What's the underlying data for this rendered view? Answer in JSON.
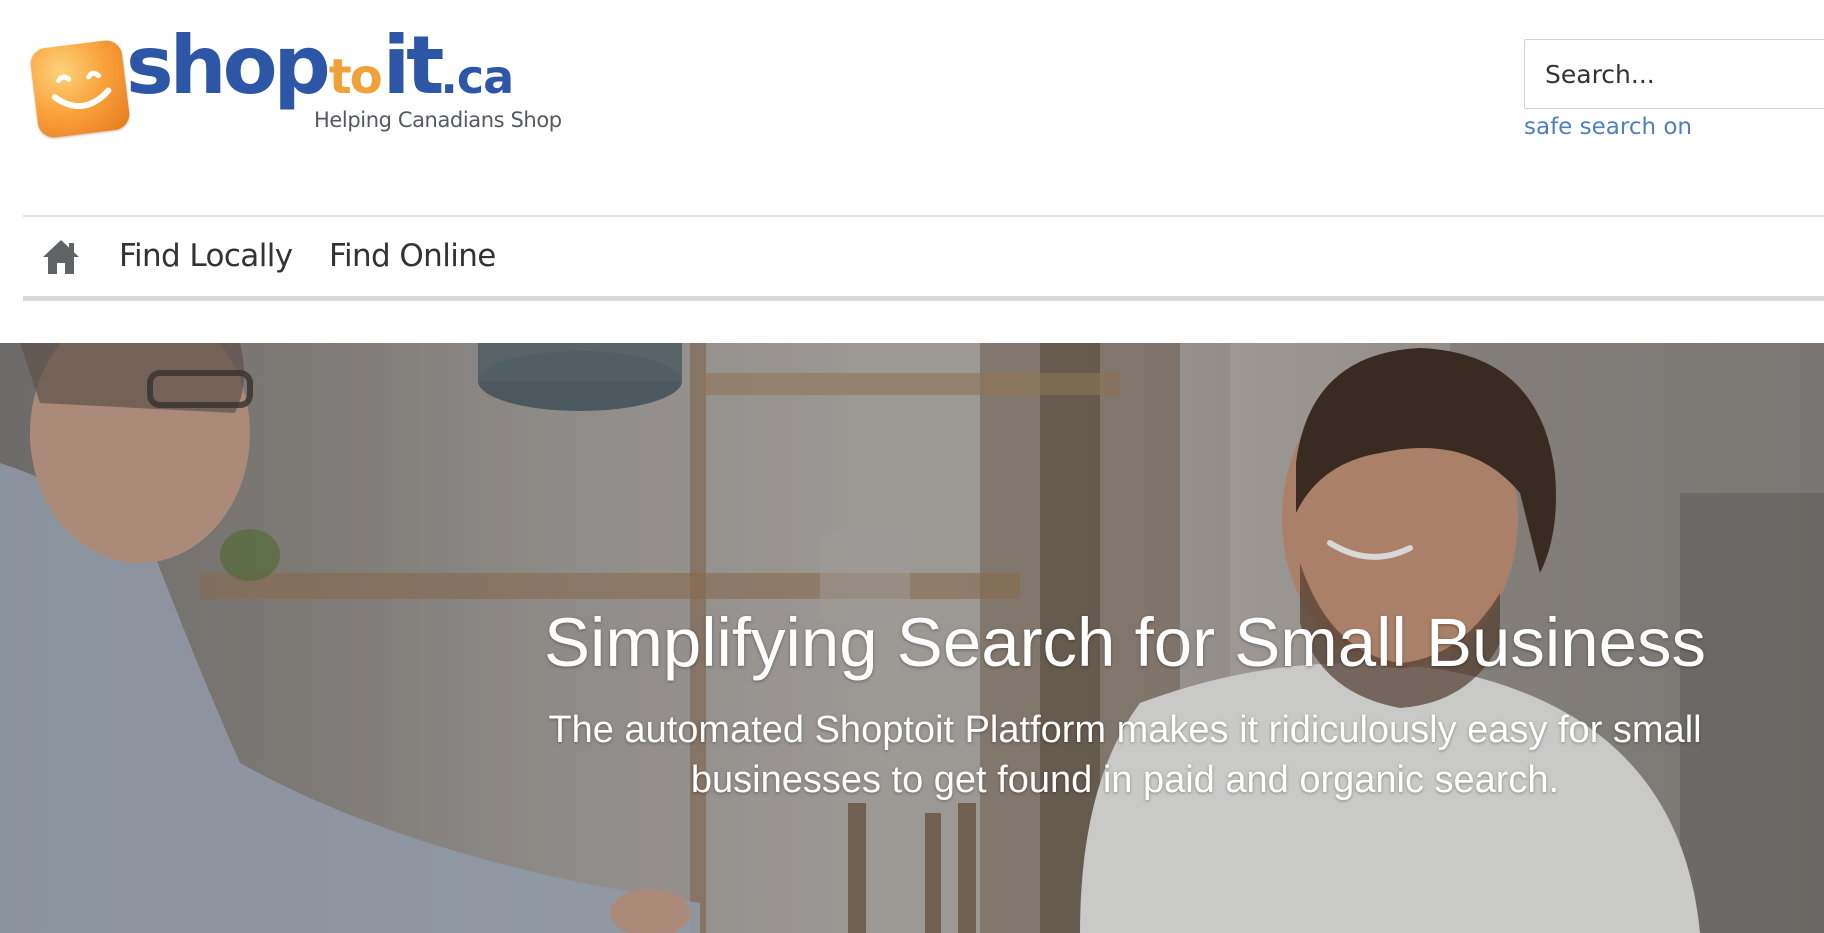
{
  "header": {
    "logo": {
      "word_shop": "shop",
      "word_to": "to",
      "word_it": "it",
      "word_ca": ".ca",
      "tagline": "Helping Canadians Shop",
      "icon": "smiley-badge-icon"
    },
    "search": {
      "placeholder": "Search...",
      "value": "",
      "safe_search_label": "safe search on"
    }
  },
  "nav": {
    "home_icon": "home-icon",
    "items": [
      {
        "label": "Find Locally"
      },
      {
        "label": "Find Online"
      }
    ]
  },
  "hero": {
    "title": "Simplifying Search for Small Business",
    "subtitle": "The automated Shoptoit Platform makes it ridiculously easy for small businesses to get found in paid and organic search."
  },
  "colors": {
    "brand_blue": "#2e56a6",
    "brand_orange": "#f0a23a",
    "link_blue": "#4f7fbf",
    "nav_text": "#333333"
  }
}
